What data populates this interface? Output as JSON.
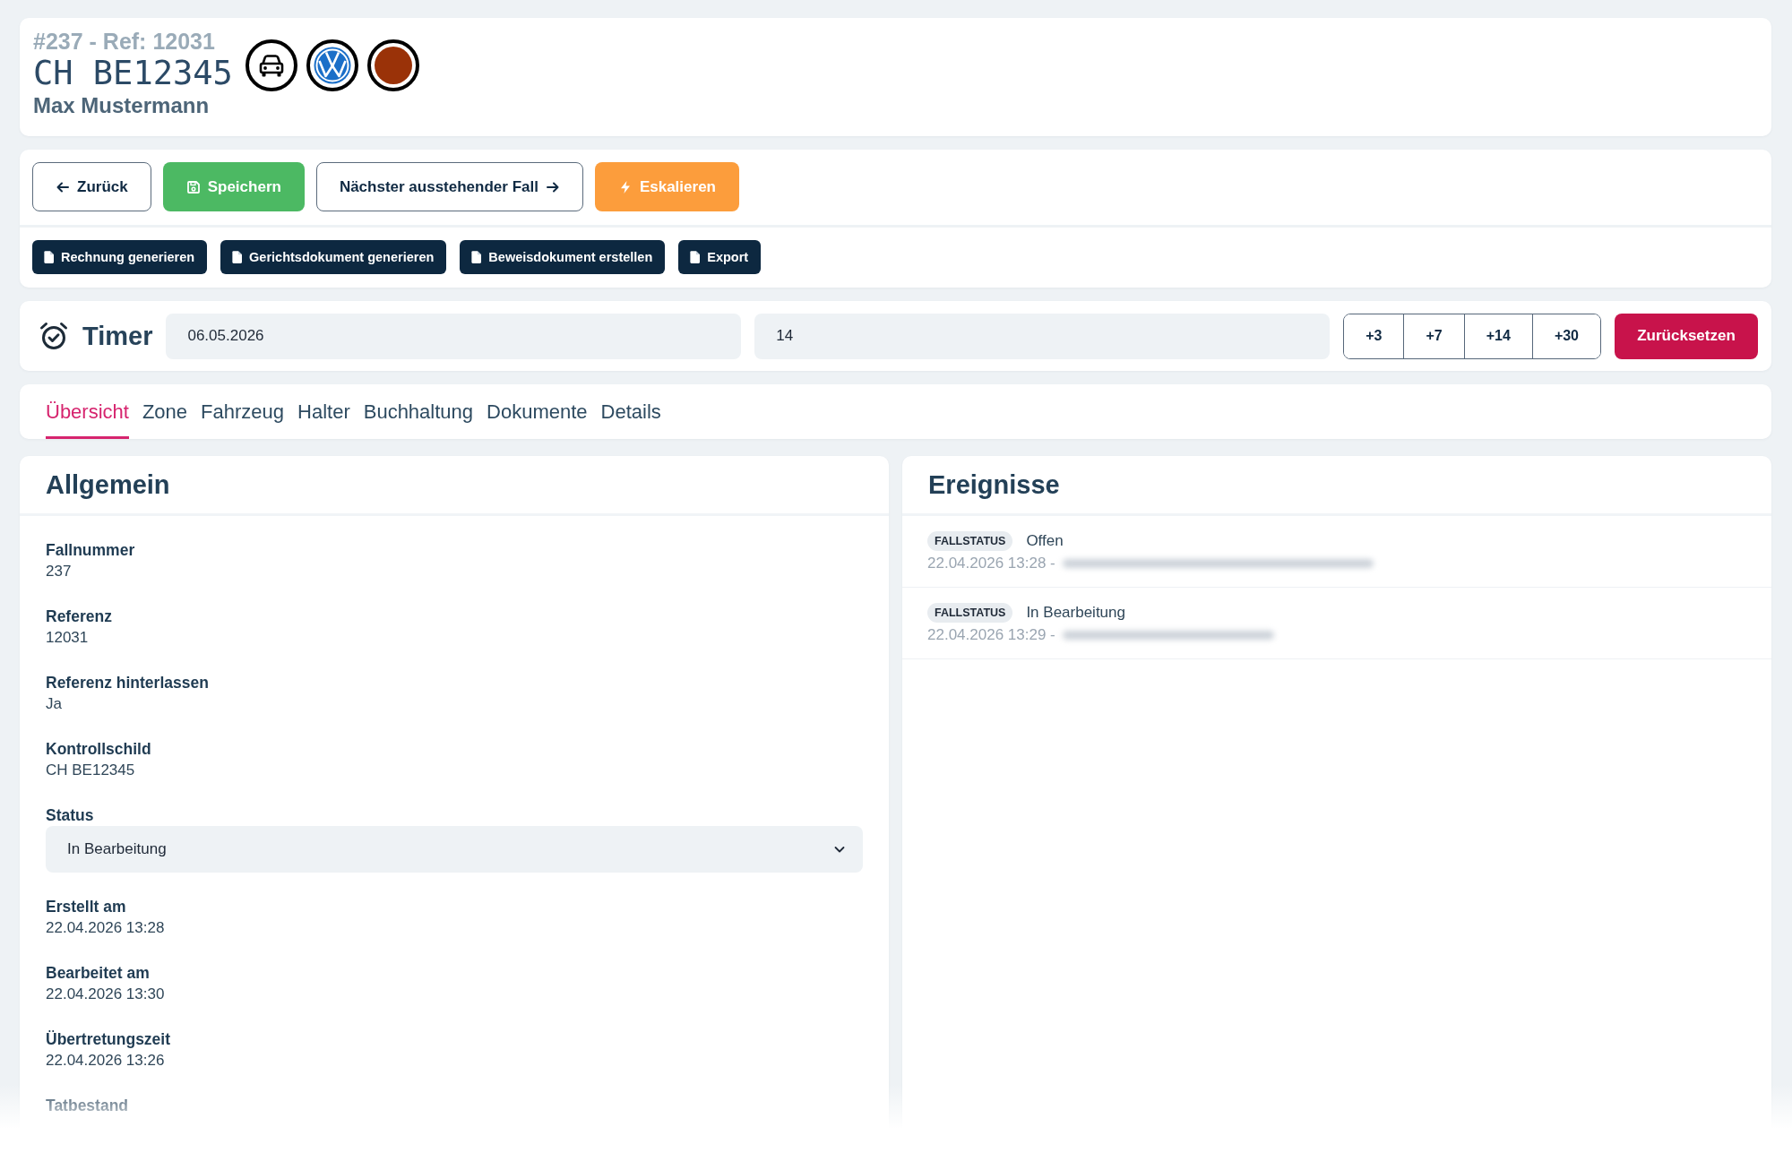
{
  "header": {
    "case_line": "#237 - Ref: 12031",
    "plate": "CH BE12345",
    "owner": "Max Mustermann",
    "badges": [
      {
        "kind": "vehicle"
      },
      {
        "kind": "brand"
      },
      {
        "kind": "color",
        "color": "#9a3208"
      }
    ]
  },
  "actions": [
    {
      "kind": "back",
      "label": "Zurück"
    },
    {
      "kind": "save",
      "label": "Speichern"
    },
    {
      "kind": "next",
      "label": "Nächster ausstehender Fall"
    },
    {
      "kind": "escalate",
      "label": "Eskalieren"
    }
  ],
  "documents": [
    {
      "label": "Rechnung generieren"
    },
    {
      "label": "Gerichtsdokument generieren"
    },
    {
      "label": "Beweisdokument erstellen"
    },
    {
      "label": "Export"
    }
  ],
  "timer": {
    "title": "Timer",
    "date": "06.05.2026",
    "days": "14",
    "increments": [
      "+3",
      "+7",
      "+14",
      "+30"
    ],
    "reset": "Zurücksetzen"
  },
  "tabs": [
    {
      "label": "Übersicht",
      "selected": true
    },
    {
      "label": "Zone",
      "selected": false
    },
    {
      "label": "Fahrzeug",
      "selected": false
    },
    {
      "label": "Halter",
      "selected": false
    },
    {
      "label": "Buchhaltung",
      "selected": false
    },
    {
      "label": "Dokumente",
      "selected": false
    },
    {
      "label": "Details",
      "selected": false
    }
  ],
  "general": {
    "title": "Allgemein",
    "fields": [
      {
        "kind": "text",
        "label": "Fallnummer",
        "value": "237"
      },
      {
        "kind": "text",
        "label": "Referenz",
        "value": "12031"
      },
      {
        "kind": "text",
        "label": "Referenz hinterlassen",
        "value": "Ja"
      },
      {
        "kind": "text",
        "label": "Kontrollschild",
        "value": "CH BE12345"
      },
      {
        "kind": "select",
        "label": "Status",
        "value": "In Bearbeitung"
      },
      {
        "kind": "text",
        "label": "Erstellt am",
        "value": "22.04.2026 13:28"
      },
      {
        "kind": "text",
        "label": "Bearbeitet am",
        "value": "22.04.2026 13:30"
      },
      {
        "kind": "text",
        "label": "Übertretungszeit",
        "value": "22.04.2026 13:26"
      },
      {
        "kind": "text",
        "label": "Tatbestand"
      }
    ]
  },
  "events": {
    "title": "Ereignisse",
    "items": [
      {
        "type": "FALLSTATUS",
        "text": "Offen",
        "time": "22.04.2026 13:28 -"
      },
      {
        "type": "FALLSTATUS",
        "text": "In Bearbeitung",
        "time": "22.04.2026 13:29 -"
      }
    ]
  }
}
